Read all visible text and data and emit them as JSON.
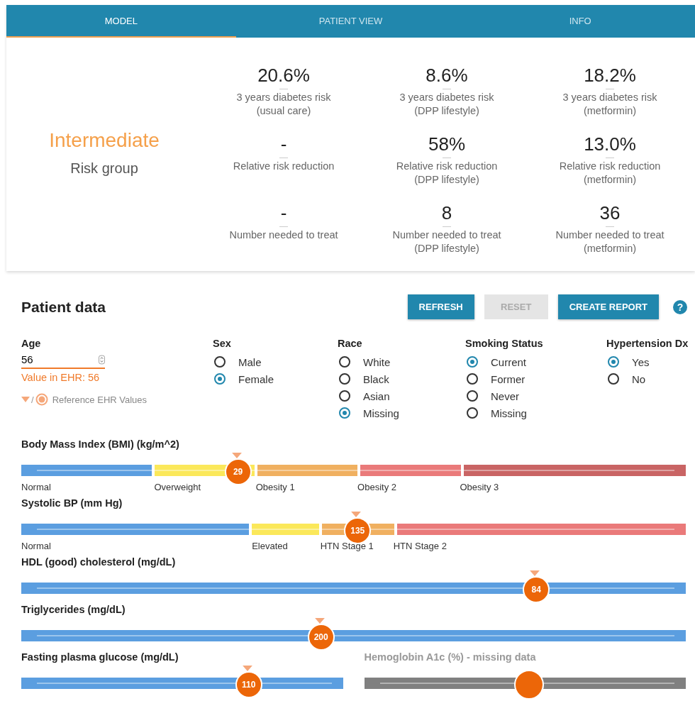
{
  "tabs": [
    {
      "label": "MODEL",
      "selected": true
    },
    {
      "label": "PATIENT VIEW",
      "selected": false
    },
    {
      "label": "INFO",
      "selected": false
    }
  ],
  "risk_group": {
    "value": "Intermediate",
    "label": "Risk group"
  },
  "metrics": [
    {
      "value": "20.6%",
      "label": "3 years diabetes risk",
      "sublabel": "(usual care)"
    },
    {
      "value": "8.6%",
      "label": "3 years diabetes risk",
      "sublabel": "(DPP lifestyle)"
    },
    {
      "value": "18.2%",
      "label": "3 years diabetes risk",
      "sublabel": "(metformin)"
    },
    {
      "value": "-",
      "label": "Relative risk reduction"
    },
    {
      "value": "58%",
      "label": "Relative risk reduction",
      "sublabel": "(DPP lifestyle)"
    },
    {
      "value": "13.0%",
      "label": "Relative risk reduction",
      "sublabel": "(metformin)"
    },
    {
      "value": "-",
      "label": "Number needed to treat"
    },
    {
      "value": "8",
      "label": "Number needed to treat",
      "sublabel": "(DPP lifestyle)"
    },
    {
      "value": "36",
      "label": "Number needed to treat",
      "sublabel": "(metformin)"
    }
  ],
  "patient_data": {
    "title": "Patient data",
    "buttons": [
      {
        "label": "REFRESH",
        "disabled": false
      },
      {
        "label": "RESET",
        "disabled": true
      },
      {
        "label": "CREATE REPORT",
        "disabled": false
      }
    ],
    "help": "?",
    "age": {
      "label": "Age",
      "value": "56",
      "ehr_note": "Value in EHR: 56",
      "legend_separator": "/",
      "legend": "Reference EHR Values"
    },
    "radio_groups": [
      {
        "label": "Sex",
        "options": [
          {
            "label": "Male",
            "selected": false
          },
          {
            "label": "Female",
            "selected": true
          }
        ]
      },
      {
        "label": "Race",
        "options": [
          {
            "label": "White",
            "selected": false
          },
          {
            "label": "Black",
            "selected": false
          },
          {
            "label": "Asian",
            "selected": false
          },
          {
            "label": "Missing",
            "selected": true
          }
        ]
      },
      {
        "label": "Smoking Status",
        "options": [
          {
            "label": "Current",
            "selected": true
          },
          {
            "label": "Former",
            "selected": false
          },
          {
            "label": "Never",
            "selected": false
          },
          {
            "label": "Missing",
            "selected": false
          }
        ]
      },
      {
        "label": "Hypertension Dx",
        "options": [
          {
            "label": "Yes",
            "selected": true
          },
          {
            "label": "No",
            "selected": false
          }
        ]
      }
    ]
  },
  "slider_rows": [
    [
      {
        "label": "Body Mass Index (BMI) (kg/m^2)",
        "value": "29",
        "missing": false,
        "level": 0.324,
        "ehr_marker": true,
        "segments": [
          {
            "label": "Normal",
            "color": "#5b9ee0"
          },
          {
            "label": "Overweight",
            "color": "#fbe85a"
          },
          {
            "label": "Obesity 1",
            "color": "#f0b060"
          },
          {
            "label": "Obesity 2",
            "color": "#ea7a7a"
          },
          {
            "label": "Obesity 3",
            "color": "#c96464"
          }
        ]
      }
    ],
    [
      {
        "label": "Systolic BP (mm Hg)",
        "value": "135",
        "missing": false,
        "level": 0.504,
        "ehr_marker": true,
        "segments": [
          {
            "label": "Normal",
            "color": "#5b9ee0"
          },
          {
            "label": "Elevated",
            "color": "#fbe85a"
          },
          {
            "label": "HTN Stage 1",
            "color": "#f0b060"
          },
          {
            "label": "HTN Stage 2",
            "color": "#ea7a7a"
          }
        ]
      }
    ],
    [
      {
        "label": "HDL (good) cholesterol (mg/dL)",
        "value": "84",
        "missing": false,
        "level": 0.773,
        "ehr_marker": true,
        "segments": [
          {
            "color": "#5b9ee0"
          }
        ]
      }
    ],
    [
      {
        "label": "Triglycerides (mg/dL)",
        "value": "200",
        "missing": false,
        "level": 0.449,
        "ehr_marker": true,
        "segments": [
          {
            "color": "#5b9ee0"
          }
        ]
      }
    ],
    [
      {
        "label": "Fasting plasma glucose (mg/dL)",
        "value": "110",
        "missing": false,
        "level": 0.703,
        "ehr_marker": true,
        "segments": [
          {
            "color": "#5b9ee0"
          }
        ]
      },
      {
        "label": "Hemoglobin A1c (%) - missing data",
        "missing": true,
        "level": 0.508,
        "ehr_marker": false,
        "segments": [
          {
            "color": "#808080"
          }
        ]
      }
    ]
  ]
}
